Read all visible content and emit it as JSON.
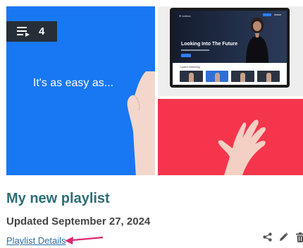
{
  "playlist": {
    "item_count": "4",
    "title": "My new playlist",
    "updated": "Updated September 27, 2024",
    "details_link": "Playlist Details"
  },
  "thumbnails": {
    "main_tagline": "It's as easy as...",
    "web_mock": {
      "brand": "⊕ kaltura",
      "headline": "Looking Into The Future",
      "strip_label": "Content Marketing"
    }
  },
  "colors": {
    "title": "#2c6e77",
    "link": "#2a6ea8",
    "arrow": "#e0266f",
    "tile_blue": "#1877f2",
    "tile_red": "#f4354c"
  },
  "icons": {
    "queue": "playlist-queue-icon",
    "share": "share-icon",
    "edit": "pencil-icon",
    "delete": "trash-icon"
  }
}
